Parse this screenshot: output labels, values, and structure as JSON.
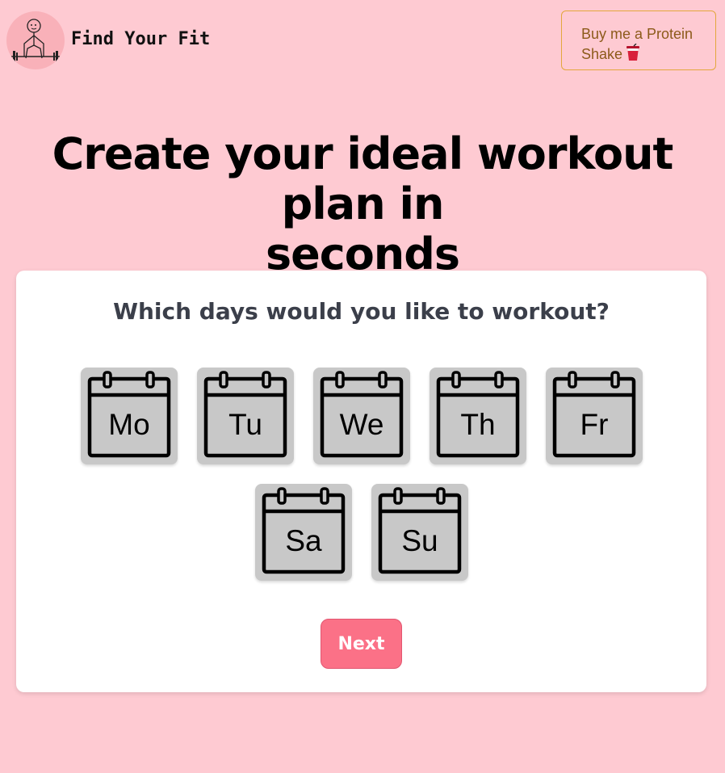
{
  "header": {
    "brand": "Find Your Fit",
    "logo_icon": "weightlifter-stick-figure-icon",
    "shake_button": {
      "line1": "Buy me a Protein",
      "line2": "Shake",
      "icon": "cup-icon"
    }
  },
  "hero": {
    "line1": "Create your ideal workout plan in",
    "line2": "seconds"
  },
  "card": {
    "question": "Which days would you like to workout?",
    "days": [
      {
        "label": "Mo",
        "icon": "calendar-icon",
        "selected": false
      },
      {
        "label": "Tu",
        "icon": "calendar-icon",
        "selected": false
      },
      {
        "label": "We",
        "icon": "calendar-icon",
        "selected": false
      },
      {
        "label": "Th",
        "icon": "calendar-icon",
        "selected": false
      },
      {
        "label": "Fr",
        "icon": "calendar-icon",
        "selected": false
      },
      {
        "label": "Sa",
        "icon": "calendar-icon",
        "selected": false
      },
      {
        "label": "Su",
        "icon": "calendar-icon",
        "selected": false
      }
    ],
    "next_label": "Next"
  },
  "colors": {
    "background": "#fecad2",
    "card": "#ffffff",
    "day_tile": "#c8c8c8",
    "next_button": "#fb7187",
    "shake_border": "#e3a73c",
    "shake_text": "#8c5a1a"
  }
}
